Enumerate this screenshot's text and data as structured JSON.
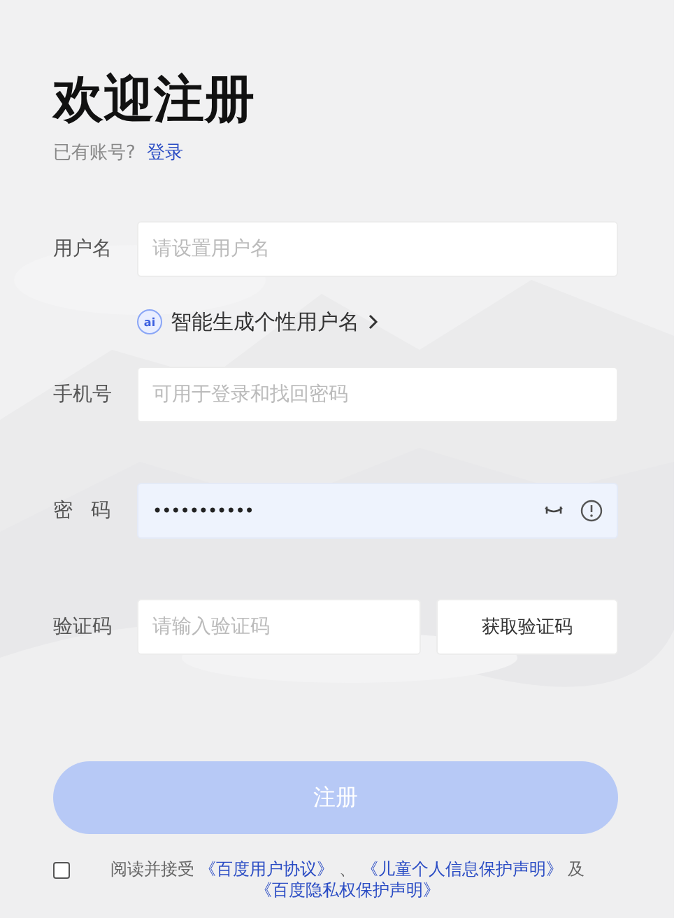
{
  "title": "欢迎注册",
  "login_prompt": {
    "text": "已有账号?",
    "link": "登录"
  },
  "rows": [
    {
      "kind": "text",
      "label": "用户名",
      "placeholder": "请设置用户名"
    },
    {
      "kind": "suggestion",
      "badge": "ai",
      "text": "智能生成个性用户名"
    },
    {
      "kind": "text",
      "label": "手机号",
      "placeholder": "可用于登录和找回密码"
    },
    {
      "kind": "password",
      "label": "密 码",
      "value": "•••••••••••",
      "focused": true
    },
    {
      "kind": "code",
      "label": "验证码",
      "placeholder": "请输入验证码",
      "button": "获取验证码"
    }
  ],
  "submit": {
    "label": "注册",
    "disabled": true
  },
  "agreement": {
    "checked": false,
    "parts": [
      {
        "kind": "text",
        "text": "阅读并接受"
      },
      {
        "kind": "link",
        "text": "《百度用户协议》"
      },
      {
        "kind": "text",
        "text": "、"
      },
      {
        "kind": "link",
        "text": "《儿童个人信息保护声明》"
      },
      {
        "kind": "text",
        "text": "及"
      },
      {
        "kind": "link",
        "text": "《百度隐私权保护声明》"
      }
    ]
  }
}
